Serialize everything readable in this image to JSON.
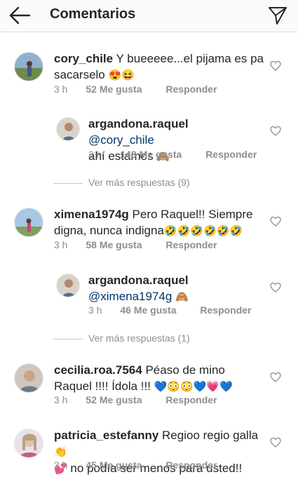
{
  "header": {
    "title": "Comentarios",
    "back_icon": "arrow-left-icon",
    "share_icon": "paper-plane-icon"
  },
  "comments": [
    {
      "user": "cory_chile",
      "text": "Y bueeeee...el pijama es pa sacarselo",
      "emoji": "😍😆",
      "time": "3 h",
      "likes": "52 Me gusta",
      "reply": "Responder"
    },
    {
      "user": "argandona.raquel",
      "mention": "@cory_chile",
      "text": "ahí estamos",
      "emoji": "🙈",
      "time": "3 h",
      "likes": "148 Me gusta",
      "reply": "Responder"
    },
    {
      "user": "ximena1974g",
      "text": "Pero Raquel!! Siempre digna, nunca indigna",
      "emoji": "🤣🤣🤣🤣🤣🤣",
      "time": "3 h",
      "likes": "58 Me gusta",
      "reply": "Responder"
    },
    {
      "user": "argandona.raquel",
      "mention": "@ximena1974g",
      "text": "",
      "emoji": "🙈",
      "time": "3 h",
      "likes": "46 Me gusta",
      "reply": "Responder"
    },
    {
      "user": "cecilia.roa.7564",
      "text": "Péaso de mino Raquel !!!! Ídola !!!",
      "emoji": "💙😳😳💙💗💙",
      "time": "3 h",
      "likes": "52 Me gusta",
      "reply": "Responder"
    },
    {
      "user": "patricia_estefanny",
      "text": "Regioo regio galla",
      "emoji_mid": "👏",
      "emoji": "💕",
      "text2": "no podía ser menos para usted!!",
      "time": "3 h",
      "likes": "45 Me gusta",
      "reply": "Responder"
    }
  ],
  "more_replies": [
    {
      "label": "Ver más respuestas (9)"
    },
    {
      "label": "Ver más respuestas (1)"
    }
  ],
  "colors": {
    "mention": "#003569",
    "meta": "#8e8e8e",
    "text": "#262626"
  }
}
